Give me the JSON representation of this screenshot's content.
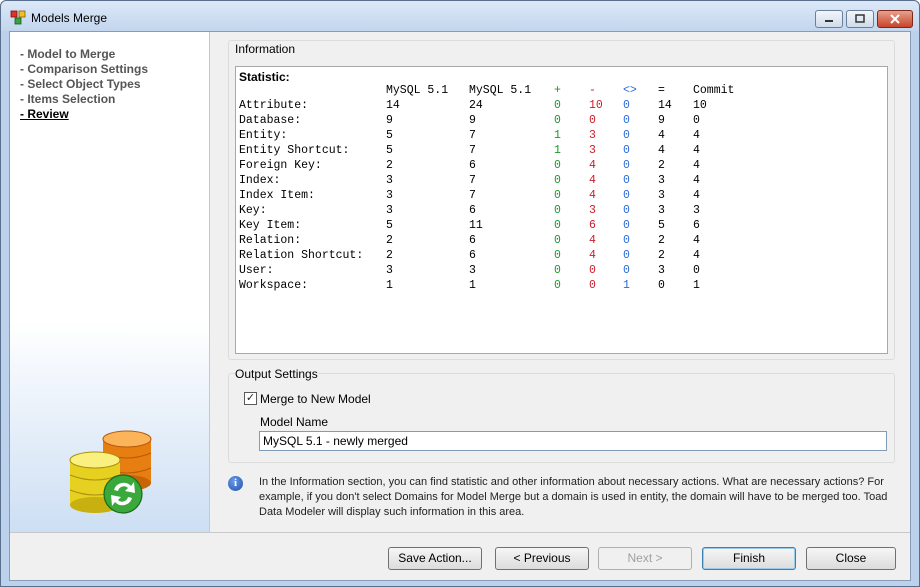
{
  "window": {
    "title": "Models Merge"
  },
  "sidebar": {
    "items": [
      {
        "label": "- Model to Merge"
      },
      {
        "label": "- Comparison Settings"
      },
      {
        "label": "- Select Object Types"
      },
      {
        "label": "- Items Selection"
      },
      {
        "label": "- Review"
      }
    ],
    "active_index": 4
  },
  "information": {
    "group_title": "Information",
    "statistic_title": "Statistic:",
    "columns": [
      "",
      "MySQL 5.1",
      "MySQL 5.1",
      "+",
      "-",
      "<>",
      "=",
      "Commit"
    ],
    "rows": [
      [
        "Attribute:",
        "14",
        "24",
        "0",
        "10",
        "0",
        "14",
        "10"
      ],
      [
        "Database:",
        "9",
        "9",
        "0",
        "0",
        "0",
        "9",
        "0"
      ],
      [
        "Entity:",
        "5",
        "7",
        "1",
        "3",
        "0",
        "4",
        "4"
      ],
      [
        "Entity Shortcut:",
        "5",
        "7",
        "1",
        "3",
        "0",
        "4",
        "4"
      ],
      [
        "Foreign Key:",
        "2",
        "6",
        "0",
        "4",
        "0",
        "2",
        "4"
      ],
      [
        "Index:",
        "3",
        "7",
        "0",
        "4",
        "0",
        "3",
        "4"
      ],
      [
        "Index Item:",
        "3",
        "7",
        "0",
        "4",
        "0",
        "3",
        "4"
      ],
      [
        "Key:",
        "3",
        "6",
        "0",
        "3",
        "0",
        "3",
        "3"
      ],
      [
        "Key Item:",
        "5",
        "11",
        "0",
        "6",
        "0",
        "5",
        "6"
      ],
      [
        "Relation:",
        "2",
        "6",
        "0",
        "4",
        "0",
        "2",
        "4"
      ],
      [
        "Relation Shortcut:",
        "2",
        "6",
        "0",
        "4",
        "0",
        "2",
        "4"
      ],
      [
        "User:",
        "3",
        "3",
        "0",
        "0",
        "0",
        "3",
        "0"
      ],
      [
        "Workspace:",
        "1",
        "1",
        "0",
        "0",
        "1",
        "0",
        "1"
      ]
    ],
    "colors": {
      "added": "#1a9a2a",
      "removed": "#c8202a",
      "changed": "#2a6ad8"
    }
  },
  "output": {
    "group_title": "Output Settings",
    "merge_checkbox_label": "Merge to New Model",
    "merge_checked": true,
    "model_name_label": "Model Name",
    "model_name_value": "MySQL 5.1 - newly merged"
  },
  "hint": {
    "icon": "info-icon",
    "text": "In the Information section, you can find statistic and other information about necessary actions. What are necessary actions? For example, if you don't select Domains for Model Merge but a domain is used in entity, the domain will have to be merged too. Toad Data Modeler will display such information in this area."
  },
  "buttons": {
    "save_action": "Save Action...",
    "previous": "< Previous",
    "next": "Next >",
    "finish": "Finish",
    "close": "Close"
  }
}
